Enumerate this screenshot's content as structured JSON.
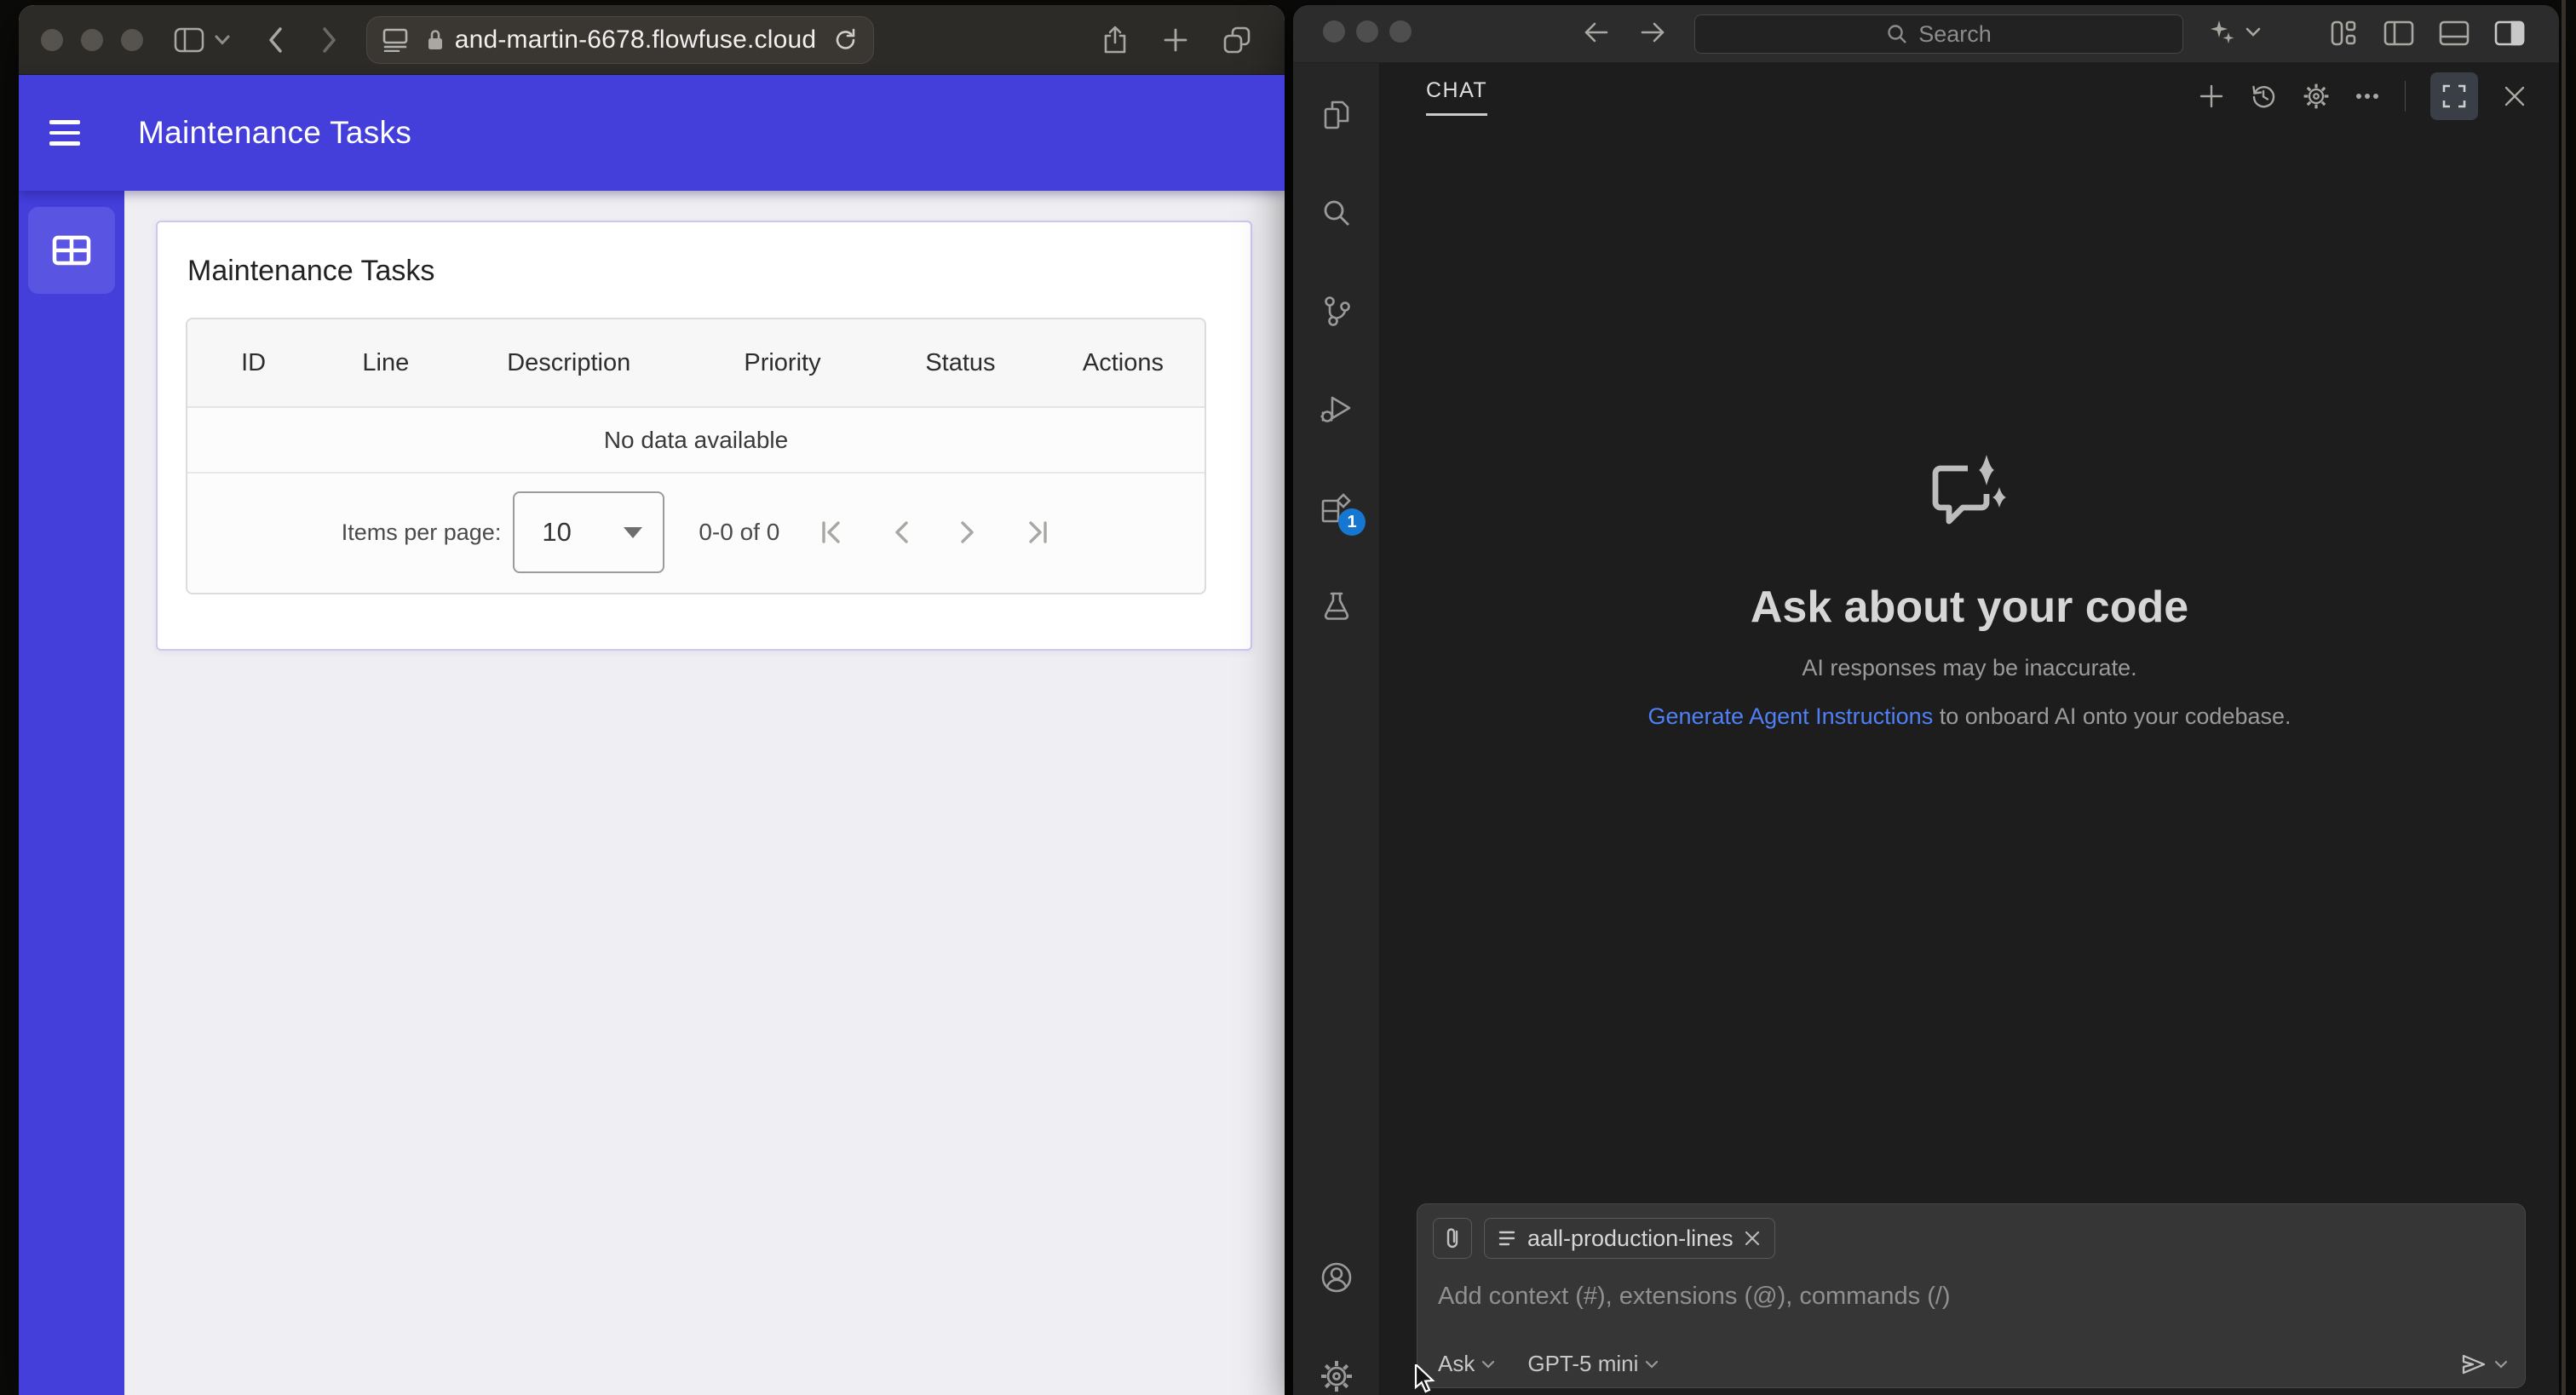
{
  "safari": {
    "url": "and-martin-6678.flowfuse.cloud",
    "app": {
      "header_title": "Maintenance Tasks",
      "card_title": "Maintenance Tasks",
      "table_columns": [
        "ID",
        "Line",
        "Description",
        "Priority",
        "Status",
        "Actions"
      ],
      "empty_message": "No data available",
      "pagination": {
        "items_per_page_label": "Items per page:",
        "page_size": "10",
        "range": "0-0 of 0"
      }
    }
  },
  "vscode": {
    "search_placeholder": "Search",
    "activity": {
      "extensions_badge": "1"
    },
    "chat": {
      "tab": "CHAT",
      "empty": {
        "title": "Ask about your code",
        "disclaimer": "AI responses may be inaccurate.",
        "link": "Generate Agent Instructions",
        "link_suffix": " to onboard AI onto your codebase."
      },
      "input": {
        "chip": "aall-production-lines",
        "placeholder": "Add context (#), extensions (@), commands (/)",
        "mode": "Ask",
        "model": "GPT-5 mini"
      }
    }
  },
  "colors": {
    "header_purple": "#443edb",
    "selected_tile": "#5a54e2",
    "link_blue": "#5080f5",
    "badge_blue": "#1677d3"
  }
}
